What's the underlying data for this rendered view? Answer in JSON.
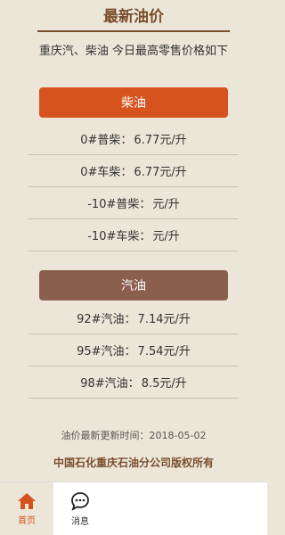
{
  "header": {
    "title": "最新油价",
    "subtitle": "重庆汽、柴油 今日最高零售价格如下"
  },
  "diesel": {
    "title": "柴油",
    "items": [
      {
        "label": "0#普柴：",
        "price": "6.77元/升"
      },
      {
        "label": "0#车柴：",
        "price": "6.77元/升"
      },
      {
        "label": "-10#普柴：",
        "price": "元/升"
      },
      {
        "label": "-10#车柴：",
        "price": "元/升"
      }
    ]
  },
  "gasoline": {
    "title": "汽油",
    "items": [
      {
        "label": "92#汽油：",
        "price": "7.14元/升"
      },
      {
        "label": "95#汽油：",
        "price": "7.54元/升"
      },
      {
        "label": "98#汽油：",
        "price": "8.5元/升"
      }
    ]
  },
  "footer": {
    "update_time": "油价最新更新时间：2018-05-02",
    "copyright": "中国石化重庆石油分公司版权所有"
  },
  "tabbar": {
    "home": {
      "label": "首页",
      "icon": "home-icon",
      "active": true
    },
    "messages": {
      "label": "消息",
      "icon": "chat-icon",
      "active": false
    }
  },
  "colors": {
    "background": "#ece6d8",
    "title": "#7a4e2c",
    "diesel_header": "#d7531d",
    "gas_header": "#8a5f4e",
    "active_tab": "#d7531d"
  }
}
